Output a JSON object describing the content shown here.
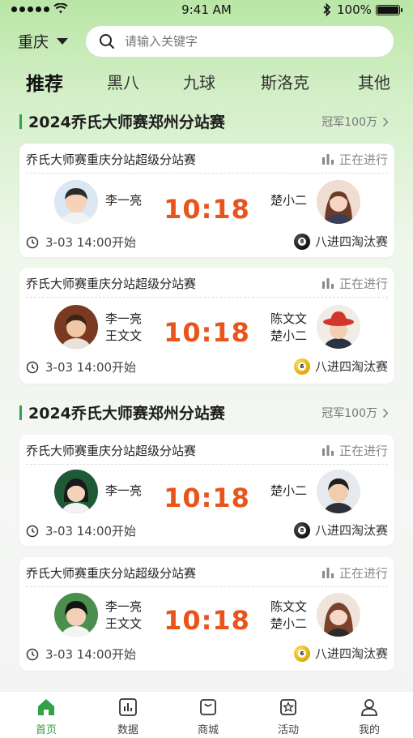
{
  "status_bar": {
    "time": "9:41 AM",
    "battery": "100%"
  },
  "header": {
    "city": "重庆",
    "search_placeholder": "请输入关键字"
  },
  "tabs": [
    {
      "label": "推荐",
      "active": true
    },
    {
      "label": "黑八",
      "active": false
    },
    {
      "label": "九球",
      "active": false
    },
    {
      "label": "斯洛克",
      "active": false
    },
    {
      "label": "其他",
      "active": false
    }
  ],
  "sections": [
    {
      "title": "2024乔氏大师赛郑州分站赛",
      "prize": "冠军100万",
      "matches": [
        {
          "title": "乔氏大师赛重庆分站超级分站赛",
          "status": "正在进行",
          "left_players": [
            "李一亮"
          ],
          "right_players": [
            "楚小二"
          ],
          "score": "10:18",
          "time": "3-03  14:00开始",
          "round": "八进四淘汰赛",
          "ball": "black",
          "ball_number": "8"
        },
        {
          "title": "乔氏大师赛重庆分站超级分站赛",
          "status": "正在进行",
          "left_players": [
            "李一亮",
            "王文文"
          ],
          "right_players": [
            "陈文文",
            "楚小二"
          ],
          "score": "10:18",
          "time": "3-03  14:00开始",
          "round": "八进四淘汰赛",
          "ball": "yellow",
          "ball_number": "6"
        }
      ]
    },
    {
      "title": "2024乔氏大师赛郑州分站赛",
      "prize": "冠军100万",
      "matches": [
        {
          "title": "乔氏大师赛重庆分站超级分站赛",
          "status": "正在进行",
          "left_players": [
            "李一亮"
          ],
          "right_players": [
            "楚小二"
          ],
          "score": "10:18",
          "time": "3-03  14:00开始",
          "round": "八进四淘汰赛",
          "ball": "black",
          "ball_number": "8"
        },
        {
          "title": "乔氏大师赛重庆分站超级分站赛",
          "status": "正在进行",
          "left_players": [
            "李一亮",
            "王文文"
          ],
          "right_players": [
            "陈文文",
            "楚小二"
          ],
          "score": "10:18",
          "time": "3-03  14:00开始",
          "round": "八进四淘汰赛",
          "ball": "yellow",
          "ball_number": "6"
        }
      ]
    }
  ],
  "bottom_nav": [
    {
      "label": "首页",
      "icon": "home-icon",
      "active": true
    },
    {
      "label": "数据",
      "icon": "chart-icon",
      "active": false
    },
    {
      "label": "商城",
      "icon": "shop-bag-icon",
      "active": false
    },
    {
      "label": "活动",
      "icon": "activity-star-icon",
      "active": false
    },
    {
      "label": "我的",
      "icon": "user-icon",
      "active": false
    }
  ],
  "colors": {
    "accent": "#2fa24a",
    "score": "#e8541c"
  }
}
